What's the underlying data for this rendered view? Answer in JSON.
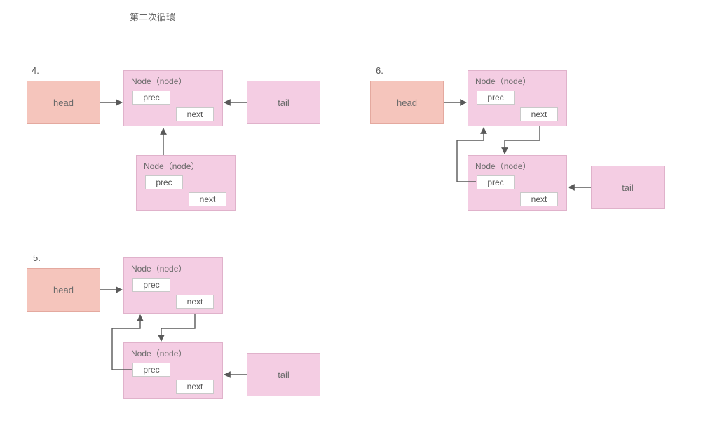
{
  "title": "第二次循環",
  "labels": {
    "head": "head",
    "tail": "tail",
    "node_title": "Node（node）",
    "prec": "prec",
    "next": "next"
  },
  "steps": {
    "s4": "4.",
    "s5": "5.",
    "s6": "6."
  },
  "colors": {
    "head_fill": "#f5c5bc",
    "head_stroke": "#e4a99f",
    "node_fill": "#f4cde3",
    "node_stroke": "#e0b2cb",
    "slot_fill": "#ffffff",
    "slot_stroke": "#c9c9c9",
    "arrow": "#595959"
  }
}
